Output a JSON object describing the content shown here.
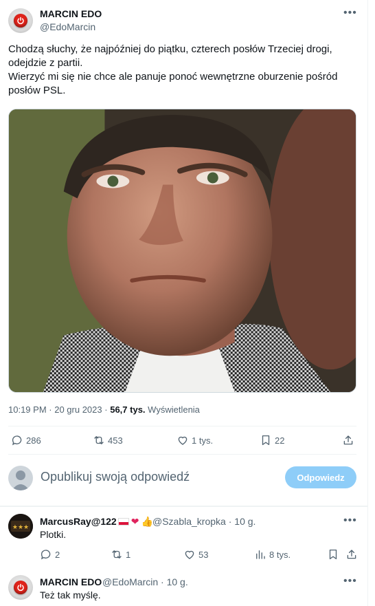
{
  "tweet": {
    "author_name": "MARCIN EDO",
    "author_handle": "@EdoMarcin",
    "more_icon": "more-horizontal-icon",
    "text_lines": [
      "Chodzą słuchy, że najpóźniej do piątku, czterech posłów Trzeciej drogi,",
      "odejdzie z partii.",
      "Wierzyć mi się nie chce ale panuje ponoć wewnętrzne oburzenie pośród",
      "posłów PSL."
    ],
    "time": "10:19 PM",
    "date": "20 gru 2023",
    "views_count": "56,7 tys.",
    "views_label": "Wyświetlenia",
    "actions": {
      "replies": "286",
      "reposts": "453",
      "likes": "1 tys.",
      "bookmarks": "22"
    }
  },
  "compose": {
    "placeholder": "Opublikuj swoją odpowiedź",
    "button_label": "Odpowiedz"
  },
  "replies": [
    {
      "name": "MarcusRay@122",
      "handle": "@Szabla_kropka",
      "age": "10 g.",
      "text": "Plotki.",
      "actions": {
        "replies": "2",
        "reposts": "1",
        "likes": "53",
        "views": "8 tys."
      }
    },
    {
      "name": "MARCIN EDO",
      "handle": "@EdoMarcin",
      "age": "10 g.",
      "text": "Też tak myślę."
    }
  ],
  "colors": {
    "accent_disabled": "#8ecdf8",
    "secondary_text": "#536471",
    "power_red": "#e0241b"
  }
}
